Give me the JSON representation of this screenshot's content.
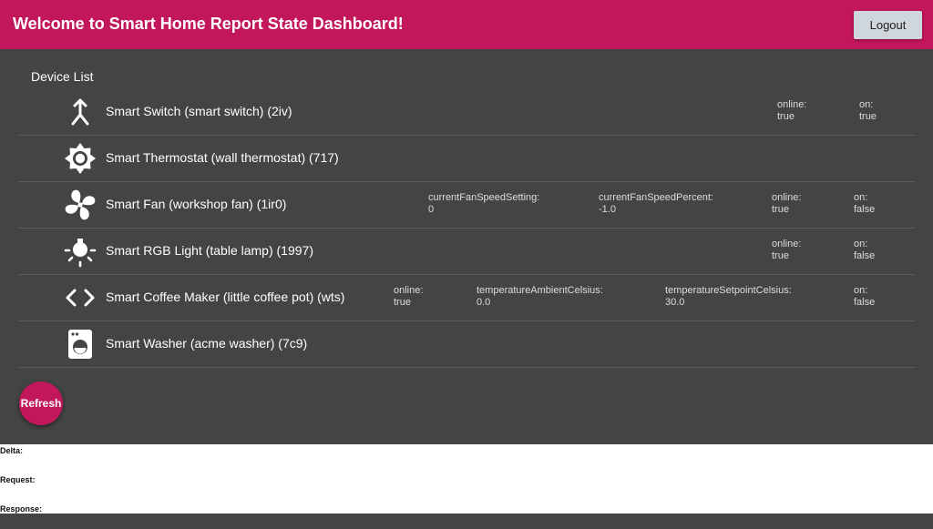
{
  "header": {
    "title": "Welcome to Smart Home Report State Dashboard!",
    "logout_label": "Logout",
    "color": "#c2185b"
  },
  "device_list": {
    "label": "Device List",
    "devices": [
      {
        "name": "Smart Switch (smart switch) (2iv)",
        "icon": "switch-merge-icon",
        "attrs": [
          {
            "key": "online:",
            "value": "true"
          },
          {
            "key": "on:",
            "value": "true"
          }
        ]
      },
      {
        "name": "Smart Thermostat (wall thermostat) (717)",
        "icon": "thermostat-gear-icon",
        "attrs": []
      },
      {
        "name": "Smart Fan (workshop fan) (1ir0)",
        "icon": "fan-icon",
        "attrs": [
          {
            "key": "currentFanSpeedSetting:",
            "value": "0"
          },
          {
            "key": "currentFanSpeedPercent:",
            "value": "-1.0"
          },
          {
            "key": "online:",
            "value": "true"
          },
          {
            "key": "on:",
            "value": "false"
          }
        ]
      },
      {
        "name": "Smart RGB Light (table lamp) (1997)",
        "icon": "light-bulb-icon",
        "attrs": [
          {
            "key": "online:",
            "value": "true"
          },
          {
            "key": "on:",
            "value": "false"
          }
        ]
      },
      {
        "name": "Smart Coffee Maker (little coffee pot) (wts)",
        "icon": "code-brackets-icon",
        "attrs": [
          {
            "key": "online:",
            "value": "true"
          },
          {
            "key": "temperatureAmbientCelsius:",
            "value": "0.0"
          },
          {
            "key": "temperatureSetpointCelsius:",
            "value": "30.0"
          },
          {
            "key": "on:",
            "value": "false"
          }
        ]
      },
      {
        "name": "Smart Washer (acme washer) (7c9)",
        "icon": "washer-icon",
        "attrs": []
      }
    ]
  },
  "refresh_label": "Refresh",
  "debug": {
    "delta_label": "Delta:",
    "request_label": "Request:",
    "response_label": "Response:"
  }
}
